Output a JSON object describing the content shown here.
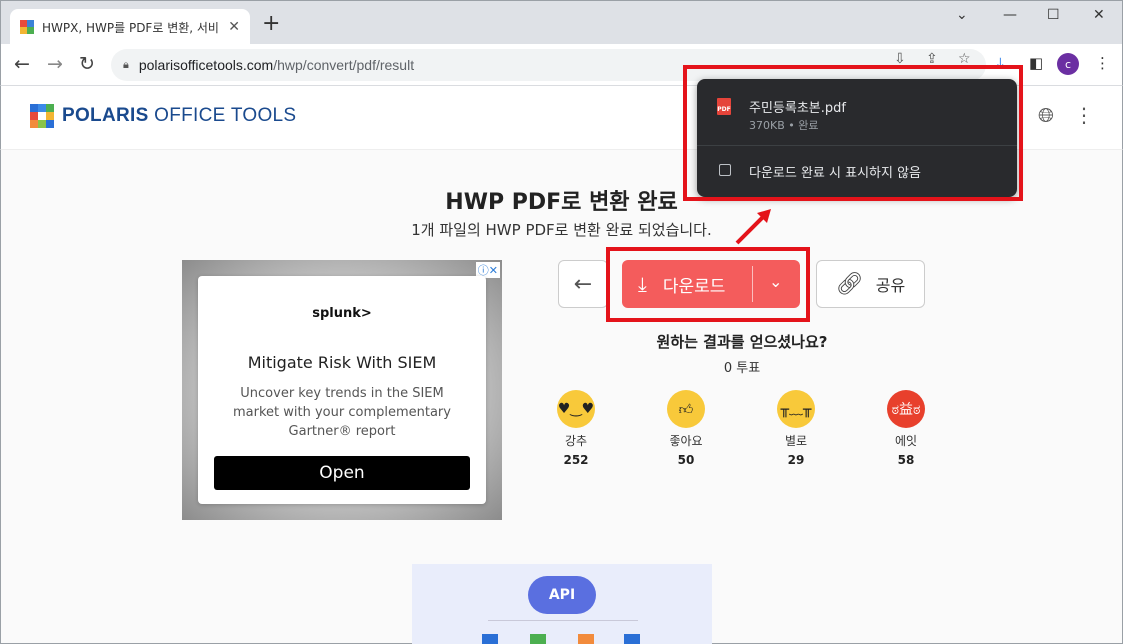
{
  "browser": {
    "tab_title": "HWPX, HWP를 PDF로 변환, 서비",
    "new_tab_icon": "plus-icon",
    "url_host": "polarisofficetools.com",
    "url_path": "/hwp/convert/pdf/result",
    "avatar_letter": "c"
  },
  "site": {
    "brand_bold": "POLARIS",
    "brand_rest": " OFFICE TOOLS"
  },
  "main": {
    "title": "HWP PDF로 변환 완료",
    "subtitle": "1개 파일의 HWP PDF로 변환 완료 되었습니다.",
    "download_label": "다운로드",
    "share_label": "공유"
  },
  "ad": {
    "brand": "splunk>",
    "headline": "Mitigate Risk With SIEM",
    "body": "Uncover key trends in the SIEM market with your complementary Gartner® report",
    "cta": "Open"
  },
  "feedback": {
    "question": "원하는 결과를 얻으셨나요?",
    "votes": "0 투표",
    "reactions": [
      {
        "label": "강추",
        "count": "252",
        "color": "#f8c93a"
      },
      {
        "label": "좋아요",
        "count": "50",
        "color": "#f8c93a"
      },
      {
        "label": "별로",
        "count": "29",
        "color": "#f8c93a"
      },
      {
        "label": "에잇",
        "count": "58",
        "color": "#e8402c"
      }
    ]
  },
  "api": {
    "label": "API"
  },
  "download_popup": {
    "file_name": "주민등록초본.pdf",
    "file_meta": "370KB • 완료",
    "pdf_icon_text": "PDF",
    "checkbox_label": "다운로드 완료 시 표시하지 않음"
  },
  "colors": {
    "accent": "#f45c5c",
    "highlight": "#e4131a",
    "popup_bg": "#292a2d"
  }
}
